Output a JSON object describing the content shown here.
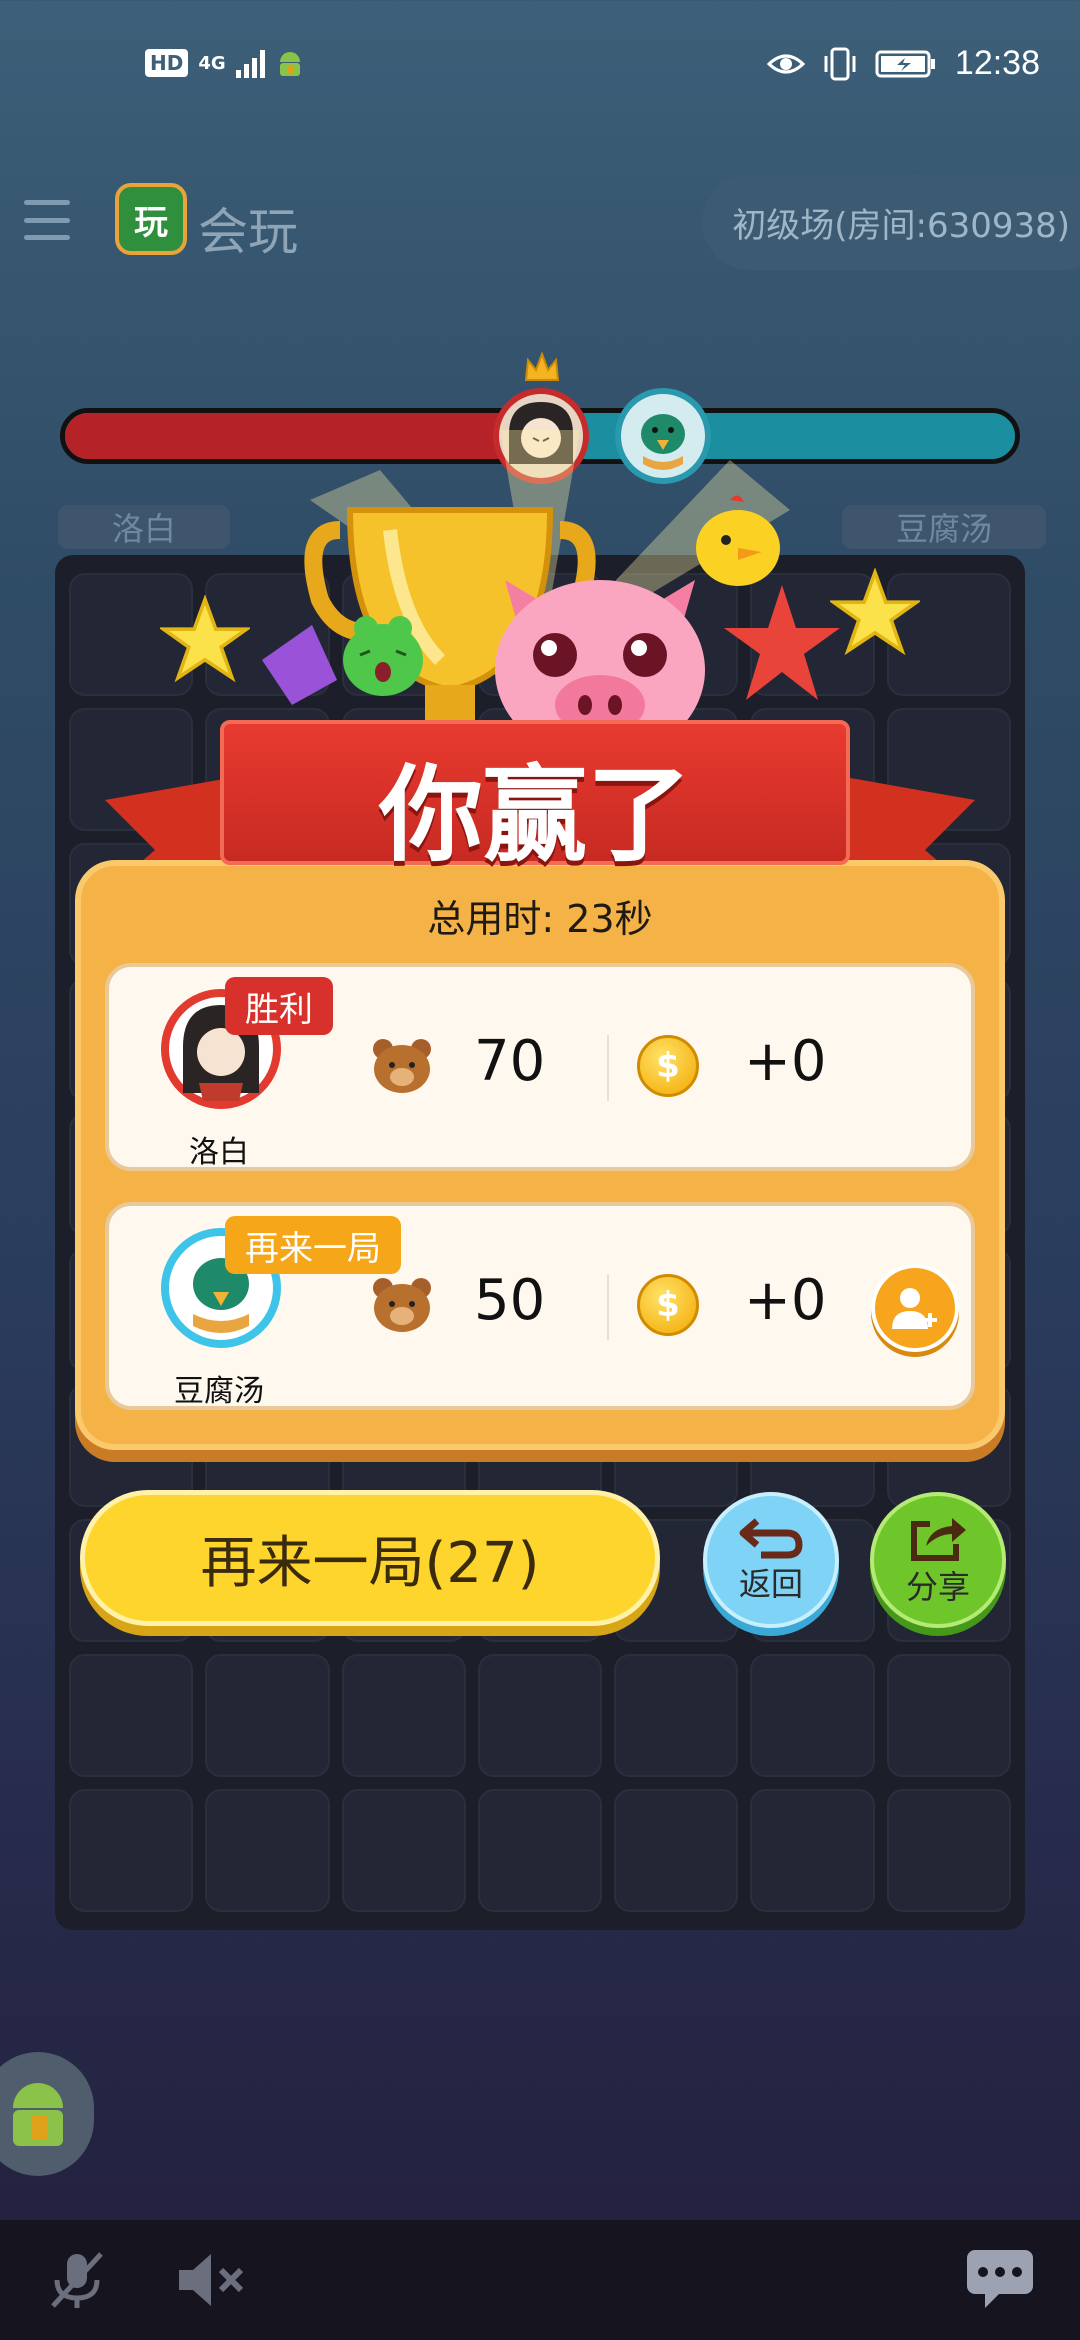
{
  "status_bar": {
    "hd": "HD",
    "network": "4G",
    "time": "12:38"
  },
  "header": {
    "logo_char": "玩",
    "app_name": "会玩",
    "room": "初级场(房间:630938)"
  },
  "progress": {
    "left_player": "洛白",
    "right_player": "豆腐汤",
    "left_fraction": 0.47
  },
  "result": {
    "title": "你赢了",
    "total_time": "总用时: 23秒",
    "players": [
      {
        "name": "洛白",
        "badge": "胜利",
        "score": "70",
        "coins": "+0"
      },
      {
        "name": "豆腐汤",
        "badge": "再来一局",
        "score": "50",
        "coins": "+0"
      }
    ]
  },
  "actions": {
    "again": "再来一局(27)",
    "back": "返回",
    "share": "分享"
  },
  "colors": {
    "red_team": "#b52227",
    "blue_team": "#1b8ea0",
    "panel": "#f5b347",
    "again_button": "#fdd52c"
  }
}
